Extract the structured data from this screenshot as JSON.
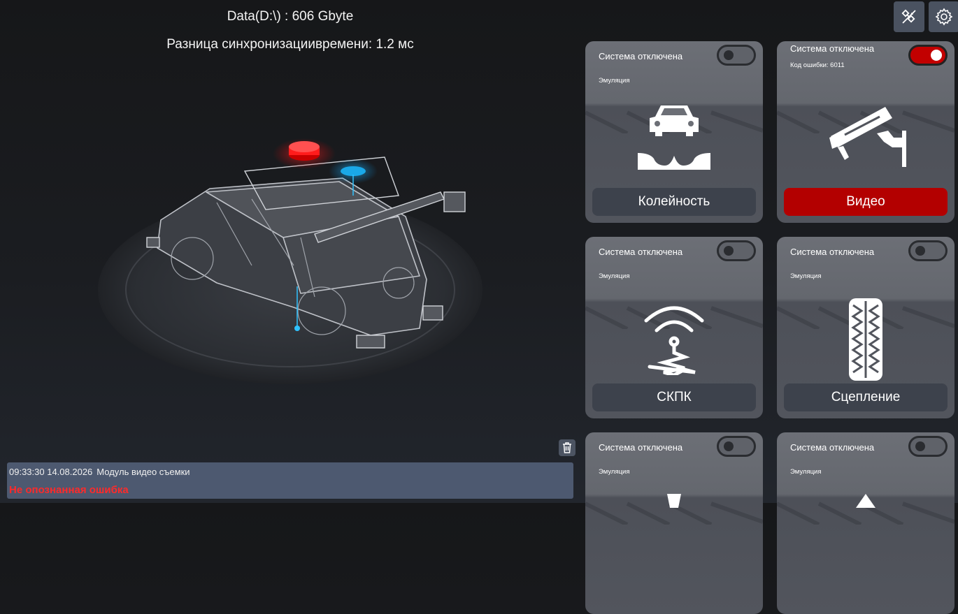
{
  "header": {
    "disk": "Data(D:\\) : 606 Gbyte",
    "sync": "Разница синхронизациивремени: 1.2 мс"
  },
  "toolbar": {
    "gps_icon": "satellite-off-icon",
    "settings_icon": "gear-icon"
  },
  "cards": [
    {
      "status": "Система отключена",
      "sub": "Эмуляция",
      "label": "Колейность",
      "toggle_on": false,
      "icon": "car-rut-icon"
    },
    {
      "status": "Система отключена",
      "sub": "Код ошибки: 6011",
      "label": "Видео",
      "toggle_on": true,
      "icon": "camera-icon"
    },
    {
      "status": "Система отключена",
      "sub": "Эмуляция",
      "label": "СКПК",
      "toggle_on": false,
      "icon": "antenna-signal-icon"
    },
    {
      "status": "Система отключена",
      "sub": "Эмуляция",
      "label": "Сцепление",
      "toggle_on": false,
      "icon": "tire-tread-icon"
    },
    {
      "status": "Система отключена",
      "sub": "Эмуляция",
      "label": "",
      "toggle_on": false,
      "icon": "sensor-icon"
    },
    {
      "status": "Система отключена",
      "sub": "Эмуляция",
      "label": "",
      "toggle_on": false,
      "icon": "arrow-up-icon"
    }
  ],
  "log": {
    "time": "09:33:30 14.08.2026",
    "module": "Модуль видео съемки",
    "message": "Не опознанная ошибка"
  },
  "colors": {
    "accent_red": "#b30000",
    "error_text": "#ff2a2a",
    "card_bg": "#64676e",
    "log_bg": "#4d5970"
  }
}
